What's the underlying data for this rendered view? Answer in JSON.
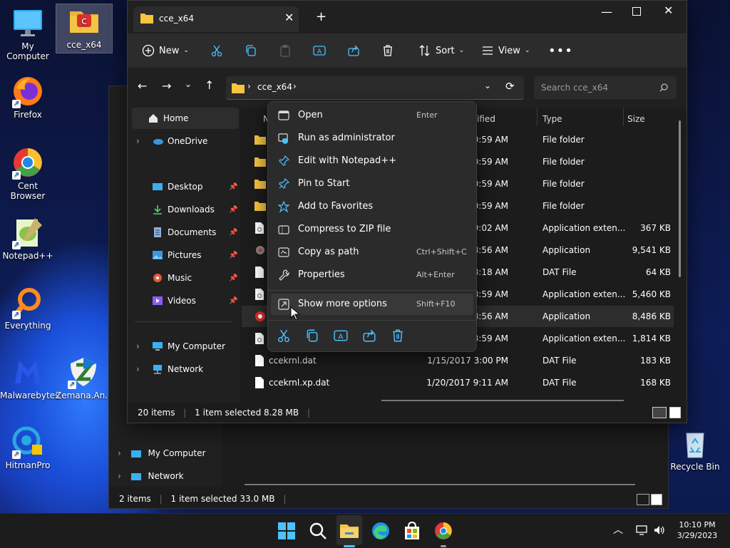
{
  "desktop": {
    "icons": [
      {
        "label": "My Computer"
      },
      {
        "label": "cce_x64"
      },
      {
        "label": "Firefox"
      },
      {
        "label": "Cent Browser"
      },
      {
        "label": "Notepad++"
      },
      {
        "label": "Everything"
      },
      {
        "label": "Malwarebytes"
      },
      {
        "label": "Zemana.An..."
      },
      {
        "label": "HitmanPro"
      },
      {
        "label": "Recycle Bin"
      }
    ]
  },
  "back_window": {
    "nav_items": [
      "My Computer",
      "Network"
    ],
    "status": {
      "items": "2 items",
      "selected": "1 item selected  33.0 MB"
    }
  },
  "window": {
    "tab_title": "cce_x64",
    "toolbar": {
      "new_label": "New",
      "sort_label": "Sort",
      "view_label": "View"
    },
    "address": {
      "folder": "cce_x64"
    },
    "search": {
      "placeholder": "Search cce_x64"
    },
    "nav": {
      "home": "Home",
      "onedrive": "OneDrive",
      "quick": [
        "Desktop",
        "Downloads",
        "Documents",
        "Pictures",
        "Music",
        "Videos"
      ],
      "my_computer": "My Computer",
      "network": "Network"
    },
    "columns": {
      "name": "N",
      "modified": "ified",
      "type": "Type",
      "size": "Size"
    },
    "rows": [
      {
        "name": "",
        "modified": "10:59 AM",
        "type": "File folder",
        "size": ""
      },
      {
        "name": "",
        "modified": "10:59 AM",
        "type": "File folder",
        "size": ""
      },
      {
        "name": "",
        "modified": "10:59 AM",
        "type": "File folder",
        "size": ""
      },
      {
        "name": "",
        "modified": "10:59 AM",
        "type": "File folder",
        "size": ""
      },
      {
        "name": "",
        "modified": "9:02 AM",
        "type": "Application exten...",
        "size": "367 KB"
      },
      {
        "name": "",
        "modified": "8:56 AM",
        "type": "Application",
        "size": "9,541 KB"
      },
      {
        "name": "",
        "modified": "8:18 AM",
        "type": "DAT File",
        "size": "64 KB"
      },
      {
        "name": "",
        "modified": "8:59 AM",
        "type": "Application exten...",
        "size": "5,460 KB"
      },
      {
        "name": "",
        "modified": "8:56 AM",
        "type": "Application",
        "size": "8,486 KB"
      },
      {
        "name": "",
        "modified": "8:59 AM",
        "type": "Application exten...",
        "size": "1,814 KB"
      },
      {
        "name": "ccekrnl.dat",
        "modified": "1/15/2017 3:00 PM",
        "type": "DAT File",
        "size": "183 KB"
      },
      {
        "name": "ccekrnl.xp.dat",
        "modified": "1/20/2017 9:11 AM",
        "type": "DAT File",
        "size": "168 KB"
      }
    ],
    "status": {
      "items": "20 items",
      "selected": "1 item selected  8.28 MB"
    }
  },
  "context_menu": {
    "items": [
      {
        "label": "Open",
        "shortcut": "Enter"
      },
      {
        "label": "Run as administrator",
        "shortcut": ""
      },
      {
        "label": "Edit with Notepad++",
        "shortcut": ""
      },
      {
        "label": "Pin to Start",
        "shortcut": ""
      },
      {
        "label": "Add to Favorites",
        "shortcut": ""
      },
      {
        "label": "Compress to ZIP file",
        "shortcut": ""
      },
      {
        "label": "Copy as path",
        "shortcut": "Ctrl+Shift+C"
      },
      {
        "label": "Properties",
        "shortcut": "Alt+Enter"
      }
    ],
    "more": {
      "label": "Show more options",
      "shortcut": "Shift+F10"
    }
  },
  "taskbar": {
    "time": "10:10 PM",
    "date": "3/29/2023"
  },
  "colors": {
    "accent": "#4cc2ff",
    "folder": "#f5c542",
    "selection": "#2d2d2d"
  }
}
